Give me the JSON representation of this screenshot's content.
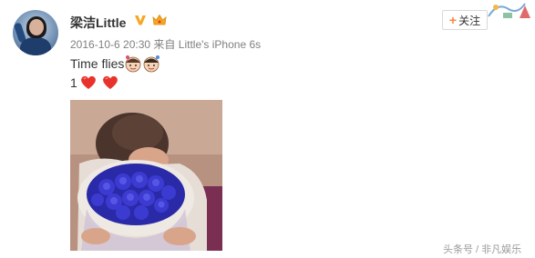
{
  "post": {
    "username": "梁洁Little",
    "timestamp": "2016-10-6 20:30",
    "source_prefix": "来自",
    "source_device": "Little's iPhone 6s",
    "text_line1": "Time flies",
    "text_line2": "1",
    "image_alt": "Photo of woman resting head on bouquet of blue roses"
  },
  "follow_button": {
    "plus": "+",
    "label": "关注"
  },
  "watermark": {
    "text": "头条号 / 非凡娱乐"
  },
  "icons": {
    "verified": "verified-v-badge-icon",
    "member": "member-crown-icon",
    "couple_emoji": "couple-faces-emoji",
    "heart": "red-heart-emoji"
  },
  "colors": {
    "verified_badge": "#f6a623",
    "follow_plus": "#ff8140",
    "meta_text": "#808080",
    "heart": "#e8322b",
    "rose_blue": "#3b3bd1"
  }
}
